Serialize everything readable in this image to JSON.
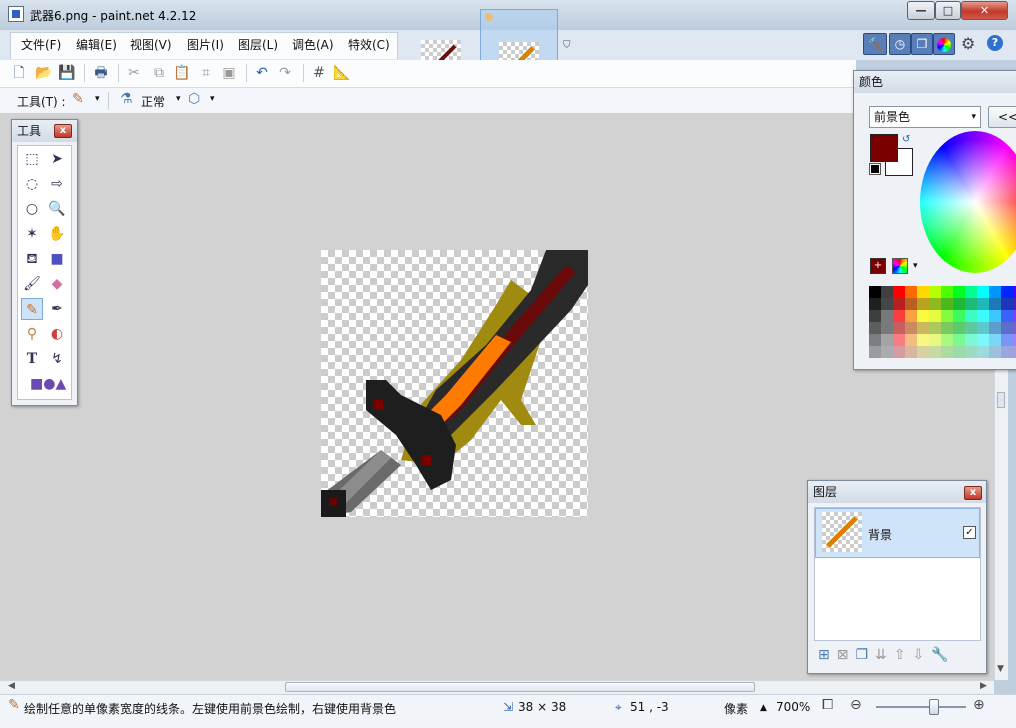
{
  "window": {
    "title": "武器6.png - paint.net 4.2.12",
    "minimize": "—",
    "maximize": "□",
    "close": "✕"
  },
  "menu": [
    "文件(F)",
    "编辑(E)",
    "视图(V)",
    "图片(I)",
    "图层(L)",
    "调色(A)",
    "特效(C)"
  ],
  "toolbar2": {
    "tool_label": "工具(T) :",
    "blend_mode": "正常"
  },
  "tools_panel": {
    "title": "工具",
    "close": "x"
  },
  "colors_panel": {
    "title": "颜色",
    "select": "前景色",
    "more_button": "<<",
    "primary_color": "#7a0000",
    "secondary_color": "#ffffff"
  },
  "layers_panel": {
    "title": "图层",
    "close": "x",
    "layer_name": "背景",
    "checkbox": "✓"
  },
  "status": {
    "hint": "绘制任意的单像素宽度的线条。左键使用前景色绘制，右键使用背景色",
    "image_size": "38 × 38",
    "cursor_pos": "51 , -3",
    "unit": "像素",
    "zoom": "700%"
  },
  "palette": [
    "#000000",
    "#404040",
    "#ff0000",
    "#ff6a00",
    "#ffd800",
    "#b6ff00",
    "#4cff00",
    "#00ff21",
    "#00ff90",
    "#00ffff",
    "#0094ff",
    "#0026ff",
    "#4800ff"
  ]
}
